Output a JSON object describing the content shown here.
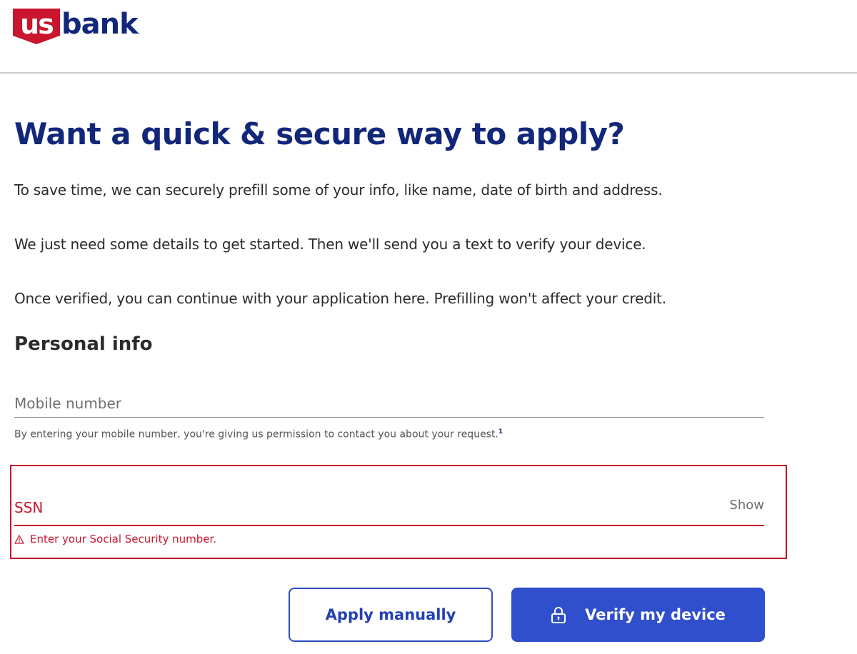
{
  "brand": {
    "logo_us": "us",
    "logo_bank": "bank",
    "logo_mark": ".",
    "colors": {
      "navy": "#12277a",
      "red": "#c9152d",
      "blue": "#2f4fcc"
    }
  },
  "header": {
    "headline": "Want a quick & secure way to apply?"
  },
  "intro": {
    "p1": "To save time, we can securely prefill some of your info, like name, date of birth and address.",
    "p2": "We just need some details to get started. Then we'll send you a text to verify your device.",
    "p3": "Once verified, you can continue with your application here. Prefilling won't affect your credit."
  },
  "personal_info": {
    "section_title": "Personal info",
    "mobile": {
      "placeholder": "Mobile number",
      "value": "",
      "help_text": "By entering your mobile number, you're giving us permission to contact you about your request.",
      "footnote": "1"
    },
    "ssn": {
      "placeholder": "SSN",
      "value": "",
      "show_label": "Show",
      "error": "Enter your Social Security number.",
      "state": "error"
    }
  },
  "actions": {
    "apply_manually_label": "Apply manually",
    "verify_label": "Verify my device",
    "verify_icon": "lock-icon"
  }
}
